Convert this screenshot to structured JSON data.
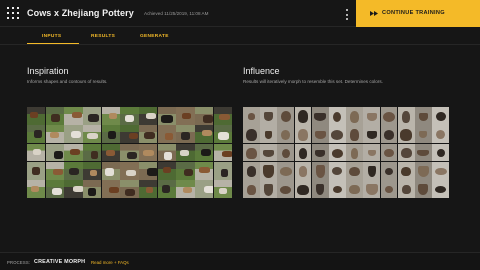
{
  "header": {
    "title": "Cows x Zhejiang Pottery",
    "achieved": "Achieved 11/25/2019, 11:08 AM",
    "menu_icon": "kebab-menu-icon",
    "continue_label": "CONTINUE TRAINING",
    "continue_icon": "fast-forward-icon",
    "accent": "#f4ba28"
  },
  "tabs": [
    {
      "label": "INPUTS",
      "active": true
    },
    {
      "label": "RESULTS",
      "active": false
    },
    {
      "label": "GENERATE",
      "active": false
    }
  ],
  "inspiration": {
    "title": "Inspiration",
    "description": "Informs shapes and contours of results."
  },
  "influence": {
    "title": "Influence",
    "description": "Results will iteratively morph to resemble this set. Determines colors."
  },
  "footer": {
    "process_label": "PROCESS:",
    "process_value": "CREATIVE MORPH",
    "read_more": "Read more + FAQs"
  }
}
